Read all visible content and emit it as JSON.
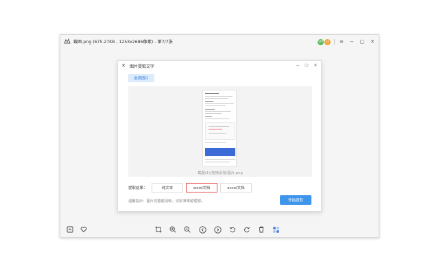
{
  "window": {
    "title": "截图.png (675.27KB , 1253x2686像素) - 第7/7张",
    "badge_green_text": "VIP",
    "badge_orange_text": "U",
    "controls": [
      "≡",
      "−",
      "▢",
      "✕"
    ]
  },
  "dialog": {
    "title": "图片提取文字",
    "controls": [
      "−",
      "▢",
      "✕"
    ],
    "select_image_label": "选择图片",
    "preview_caption": "截图(1)(拖拽添加)图片.png",
    "options_label": "提取结果：",
    "options": [
      {
        "label": "纯文本",
        "selected": false
      },
      {
        "label": "word文档",
        "selected": true
      },
      {
        "label": "excel文档",
        "selected": false
      }
    ],
    "tip": "温馨提示：图片完整越清晰，识别准率越理想。",
    "start_label": "开始提取"
  },
  "toolbar": {
    "items": [
      "save-icon",
      "heart-icon",
      "crop-icon",
      "zoom-in-icon",
      "zoom-out-icon",
      "previous-icon",
      "next-icon",
      "rotate-left-icon",
      "rotate-right-icon",
      "delete-icon",
      "tiles-icon"
    ]
  },
  "colors": {
    "accent": "#3f95ec",
    "selected_border": "#e64c4c",
    "select_btn_bg": "#dcebfb"
  }
}
